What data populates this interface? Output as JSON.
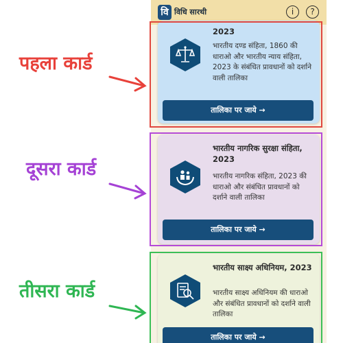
{
  "app": {
    "logo_letter": "वि",
    "title": "विधि सारथी",
    "info_glyph": "i",
    "help_glyph": "?"
  },
  "cards": [
    {
      "title": "2023",
      "description": "भारतीय दण्ड संहिता, 1860 की धाराओ और भारतीय न्याय संहिता, 2023 के संबंधित प्रावधानों को दर्शाने वाली तालिका",
      "button": "तालिका पर जाये →",
      "icon": "justice-scales-icon"
    },
    {
      "title": "भारतीय नागरिक सुरक्षा संहिता, 2023",
      "description": "भारतीय नागरिक संहिता, 2023 की धाराओ और संबंधित प्रावधानों को दर्शाने वाली तालिका",
      "button": "तालिका पर जाये →",
      "icon": "family-protection-icon"
    },
    {
      "title": "भारतीय साक्ष्य अधिनियम, 2023",
      "description": "भारतीय साक्ष्य अधिनियम की धाराओ और संबंधित प्रावधानों को दर्शाने वाली तालिका",
      "button": "तालिका पर जाये →",
      "icon": "document-search-icon"
    }
  ],
  "annotations": [
    {
      "label": "पहला कार्ड",
      "color": "#e8413a"
    },
    {
      "label": "दूसरा कार्ड",
      "color": "#a542d5"
    },
    {
      "label": "तीसरा कार्ड",
      "color": "#2fb653"
    }
  ]
}
